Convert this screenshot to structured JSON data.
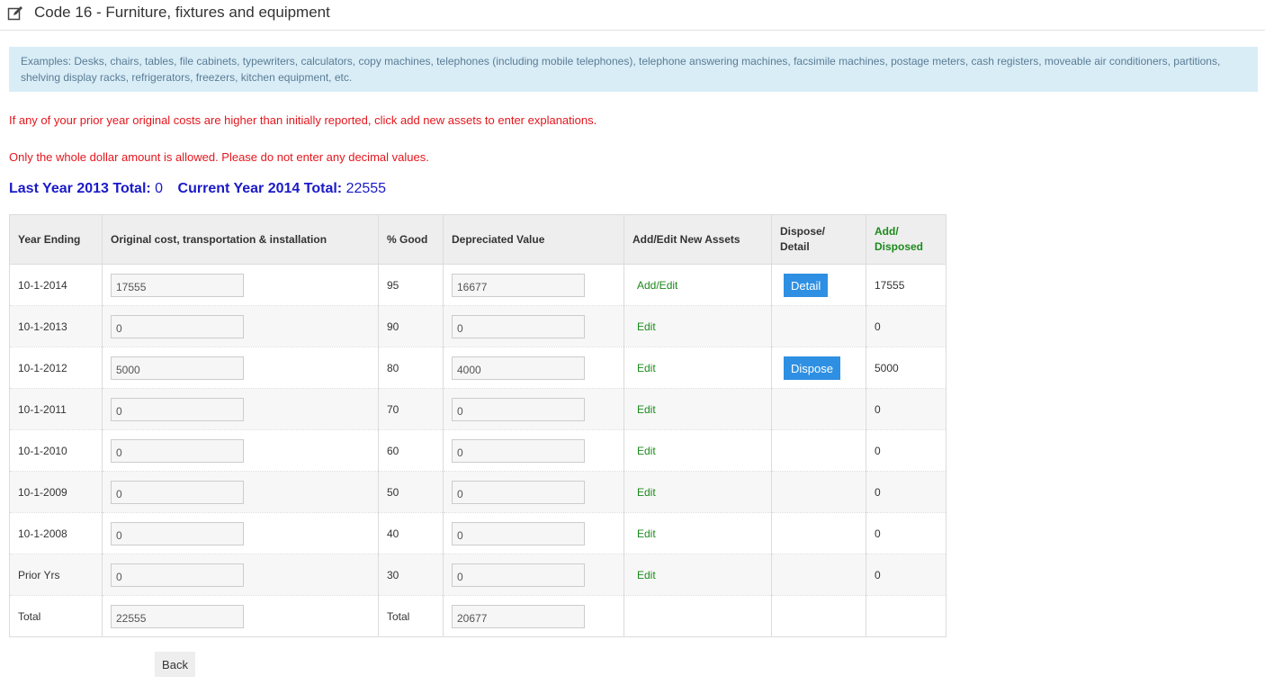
{
  "header": {
    "title": "Code 16 - Furniture, fixtures and equipment",
    "icon": "edit-icon"
  },
  "info_text": "Examples: Desks, chairs, tables, file cabinets, typewriters, calculators, copy machines, telephones (including mobile telephones), telephone answering machines, facsimile machines, postage meters, cash registers, moveable air conditioners, partitions, shelving display racks, refrigerators, freezers, kitchen equipment, etc.",
  "warnings": [
    "If any of your prior year original costs are higher than initially reported, click add new assets to enter explanations.",
    "Only the whole dollar amount is allowed. Please do not enter any decimal values."
  ],
  "totals": {
    "last_label": "Last Year 2013 Total:",
    "last_value": "0",
    "current_label": "Current Year 2014 Total:",
    "current_value": "22555"
  },
  "table": {
    "headers": {
      "year": "Year Ending",
      "cost": "Original cost, transportation & installation",
      "good": "% Good",
      "dep": "Depreciated Value",
      "addedit": "Add/Edit New Assets",
      "dispose_l1": "Dispose/",
      "dispose_l2": "Detail",
      "added_l1": "Add/",
      "added_l2": "Disposed"
    },
    "rows": [
      {
        "year": "10-1-2014",
        "cost": "17555",
        "good": "95",
        "dep": "16677",
        "link": "Add/Edit",
        "action": "Detail",
        "added": "17555"
      },
      {
        "year": "10-1-2013",
        "cost": "0",
        "good": "90",
        "dep": "0",
        "link": "Edit",
        "action": "",
        "added": "0"
      },
      {
        "year": "10-1-2012",
        "cost": "5000",
        "good": "80",
        "dep": "4000",
        "link": "Edit",
        "action": "Dispose",
        "added": "5000"
      },
      {
        "year": "10-1-2011",
        "cost": "0",
        "good": "70",
        "dep": "0",
        "link": "Edit",
        "action": "",
        "added": "0"
      },
      {
        "year": "10-1-2010",
        "cost": "0",
        "good": "60",
        "dep": "0",
        "link": "Edit",
        "action": "",
        "added": "0"
      },
      {
        "year": "10-1-2009",
        "cost": "0",
        "good": "50",
        "dep": "0",
        "link": "Edit",
        "action": "",
        "added": "0"
      },
      {
        "year": "10-1-2008",
        "cost": "0",
        "good": "40",
        "dep": "0",
        "link": "Edit",
        "action": "",
        "added": "0"
      },
      {
        "year": "Prior Yrs",
        "cost": "0",
        "good": "30",
        "dep": "0",
        "link": "Edit",
        "action": "",
        "added": "0"
      }
    ],
    "total_row": {
      "label": "Total",
      "cost": "22555",
      "good_label": "Total",
      "dep": "20677"
    }
  },
  "back_label": "Back"
}
